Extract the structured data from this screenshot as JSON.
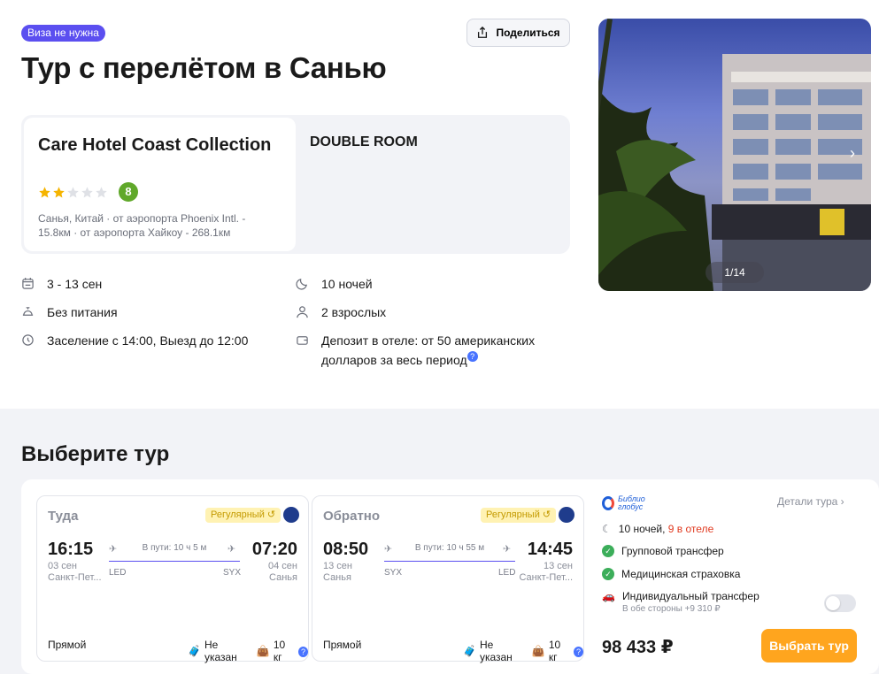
{
  "header": {
    "visa_badge": "Виза не нужна",
    "title": "Тур с перелётом в Санью",
    "share_label": "Поделиться"
  },
  "hotel": {
    "name": "Care Hotel Coast Collection",
    "stars": 2,
    "stars_max": 5,
    "rating": "8",
    "location": "Санья, Китай · от аэропорта Phoenix Intl. - 15.8км · от аэропорта Хайкоу - 268.1км",
    "room": "DOUBLE ROOM"
  },
  "details": {
    "dates": "3 - 13 сен",
    "meals": "Без питания",
    "checkin": "Заселение с 14:00, Выезд до 12:00",
    "nights": "10 ночей",
    "guests": "2 взрослых",
    "deposit": "Депозит в отеле: от 50 американских долларов за весь период"
  },
  "photo": {
    "counter": "1/14"
  },
  "tour_section": {
    "title": "Выберите тур"
  },
  "flights": [
    {
      "direction": "Туда",
      "badge": "Регулярный",
      "dep_time": "16:15",
      "dep_date": "03 сен",
      "dep_city": "Санкт-Пет...",
      "arr_time": "07:20",
      "arr_date": "04 сен",
      "arr_city": "Санья",
      "duration": "В пути: 10 ч 5 м",
      "from_code": "LED",
      "to_code": "SYX",
      "type": "Прямой",
      "baggage_hand": "Не указан",
      "baggage": "10 кг"
    },
    {
      "direction": "Обратно",
      "badge": "Регулярный",
      "dep_time": "08:50",
      "dep_date": "13 сен",
      "dep_city": "Санья",
      "arr_time": "14:45",
      "arr_date": "13 сен",
      "arr_city": "Санкт-Пет...",
      "duration": "В пути: 10 ч 55 м",
      "from_code": "SYX",
      "to_code": "LED",
      "type": "Прямой",
      "baggage_hand": "Не указан",
      "baggage": "10 кг"
    }
  ],
  "offer": {
    "operator_line1": "Библио",
    "operator_line2": "глобус",
    "details_link": "Детали тура",
    "nights": "10 ночей,",
    "nights_hotel": "9 в отеле",
    "transfer": "Групповой трансфер",
    "insurance": "Медицинская страховка",
    "individual_transfer": "Индивидуальный трансфер",
    "individual_transfer_price": "В обе стороны +9 310 ₽",
    "price": "98 433 ₽",
    "choose_label": "Выбрать тур"
  },
  "colors": {
    "accent": "#5b4ff0",
    "cta": "#ffa51e",
    "rating": "#60a82a",
    "check": "#3cae5a"
  }
}
